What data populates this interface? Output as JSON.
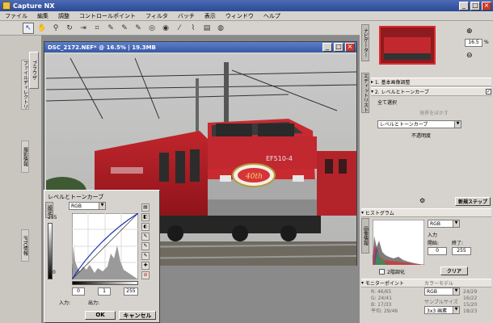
{
  "app": {
    "title": "Capture NX"
  },
  "menu": [
    "ファイル",
    "編集",
    "調整",
    "コントロールポイント",
    "フィルタ",
    "バッチ",
    "表示",
    "ウィンドウ",
    "ヘルプ"
  ],
  "toolbar": {
    "tool_icons": [
      "arrow-tool",
      "hand-tool",
      "zoom-tool",
      "rotate-tool",
      "straighten-tool",
      "crop-tool",
      "black-point-tool",
      "gray-point-tool",
      "white-point-tool",
      "color-control-point",
      "red-eye-tool",
      "brush-tool",
      "lasso-tool",
      "selection-gradient",
      "fill-tool"
    ]
  },
  "left_tabs": [
    "ブラウザ",
    "ファイルディレクトリ",
    "撮影情報",
    "IPTC情報"
  ],
  "document": {
    "title": "DSC_2172.NEF* @ 16.5% | 19.3MB",
    "locomotive_number": "EF510-4",
    "badge_text": "40th"
  },
  "curves_dialog": {
    "title": "レベルとトーンカーブ",
    "channel": "RGB",
    "top_value": "255",
    "left_value": "0",
    "inputs": [
      "0",
      "1",
      "255"
    ],
    "input_label": "入力:",
    "output_label": "出力:",
    "ok": "OK",
    "cancel": "キャンセル",
    "vtab": "設定"
  },
  "right_panel": {
    "vtab_navigator": "ナビゲーター",
    "vtab_editlist": "エディットリスト",
    "zoom": "16.5",
    "zoom_unit": "%",
    "edit_rows": [
      "1. 基本画像調整",
      "2. レベルとトーンカーブ",
      "全て選択",
      "境界をぼかす",
      "レベルとトーンカーブ",
      "不透明度"
    ],
    "new_step": "新規ステップ",
    "histogram_title": "ヒストグラム",
    "vtab_histogram": "画像情報",
    "hist_channel": "RGB",
    "hist_range": "入力",
    "hist_start": "開始:",
    "hist_end": "終了:",
    "hist_start_val": "0",
    "hist_end_val": "255",
    "two_point": "2階調化",
    "clear": "クリア",
    "monitor_title": "モニターポイント",
    "color_model": "カラーモデル",
    "color_model_val": "RGB",
    "sample_size": "サンプルサイズ",
    "sample_val": "3x3 画素",
    "rgb_rows": [
      "R:",
      "G:",
      "B:",
      "平均:"
    ],
    "rgb_a": [
      "46/65",
      "24/41",
      "17/33",
      "29/46"
    ],
    "rgb_b": [
      "24/29",
      "16/22",
      "15/20",
      "18/23"
    ]
  }
}
